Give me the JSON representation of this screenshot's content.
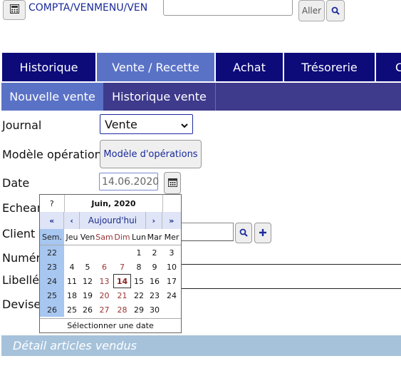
{
  "topbar": {
    "path": "COMPTA/VENMENU/VEN",
    "go_label": "Aller"
  },
  "main_tabs": [
    "Historique",
    "Vente / Recette",
    "Achat",
    "Trésorerie",
    "C"
  ],
  "sub_tabs": [
    "Nouvelle vente",
    "Historique vente"
  ],
  "form": {
    "journal_label": "Journal",
    "journal_value": "Vente",
    "modele_label": "Modèle opération",
    "modele_button": "Modèle d'opérations",
    "date_label": "Date",
    "date_value": "14.06.2020",
    "echeance_label": "Echean",
    "client_label": "Client",
    "numero_label": "Numér",
    "libelle_label": "Libellé",
    "devise_label": "Devise"
  },
  "calendar": {
    "help": "?",
    "title": "Juin, 2020",
    "nav": [
      "«",
      "‹",
      "Aujourd'hui",
      "›",
      "»"
    ],
    "headers": [
      "Sem.",
      "Jeu",
      "Ven",
      "Sam",
      "Dim",
      "Lun",
      "Mar",
      "Mer"
    ],
    "weeks": [
      {
        "wk": "22",
        "days": [
          "",
          "",
          "",
          "",
          "1",
          "2",
          "3"
        ]
      },
      {
        "wk": "23",
        "days": [
          "4",
          "5",
          "6",
          "7",
          "8",
          "9",
          "10"
        ]
      },
      {
        "wk": "24",
        "days": [
          "11",
          "12",
          "13",
          "14",
          "15",
          "16",
          "17"
        ]
      },
      {
        "wk": "25",
        "days": [
          "18",
          "19",
          "20",
          "21",
          "22",
          "23",
          "24"
        ]
      },
      {
        "wk": "26",
        "days": [
          "25",
          "26",
          "27",
          "28",
          "29",
          "30",
          ""
        ]
      }
    ],
    "today": "14",
    "footer": "Sélectionner une date"
  },
  "details_header": "Détail articles vendus",
  "icons": {
    "calculator": "calculator-icon",
    "search": "search-icon",
    "calendar": "calendar-icon",
    "add": "plus-icon",
    "dropdown": "chevron-down-icon"
  }
}
